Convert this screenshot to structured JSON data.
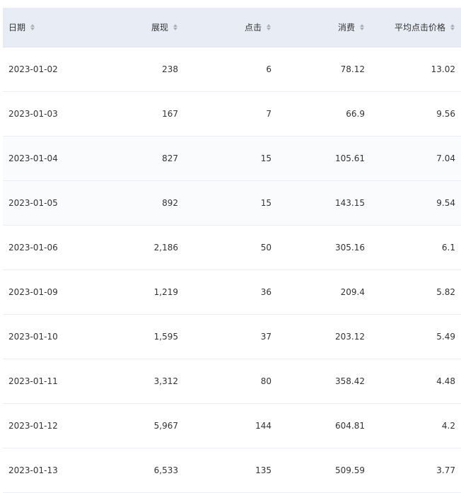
{
  "table": {
    "columns": [
      {
        "label": "日期",
        "align": "left"
      },
      {
        "label": "展现",
        "align": "right"
      },
      {
        "label": "点击",
        "align": "right"
      },
      {
        "label": "消费",
        "align": "right"
      },
      {
        "label": "平均点击价格",
        "align": "right"
      }
    ],
    "rows": [
      [
        "2023-01-02",
        "238",
        "6",
        "78.12",
        "13.02"
      ],
      [
        "2023-01-03",
        "167",
        "7",
        "66.9",
        "9.56"
      ],
      [
        "2023-01-04",
        "827",
        "15",
        "105.61",
        "7.04"
      ],
      [
        "2023-01-05",
        "892",
        "15",
        "143.15",
        "9.54"
      ],
      [
        "2023-01-06",
        "2,186",
        "50",
        "305.16",
        "6.1"
      ],
      [
        "2023-01-09",
        "1,219",
        "36",
        "209.4",
        "5.82"
      ],
      [
        "2023-01-10",
        "1,595",
        "37",
        "203.12",
        "5.49"
      ],
      [
        "2023-01-11",
        "3,312",
        "80",
        "358.42",
        "4.48"
      ],
      [
        "2023-01-12",
        "5,967",
        "144",
        "604.81",
        "4.2"
      ],
      [
        "2023-01-13",
        "6,533",
        "135",
        "509.59",
        "3.77"
      ]
    ]
  },
  "icons": {
    "sort": "sort-icon"
  },
  "colors": {
    "header_bg": "#e8ecf5",
    "row_border": "#ebeef5",
    "text": "#333333",
    "sort_icon": "#a9afbb"
  }
}
